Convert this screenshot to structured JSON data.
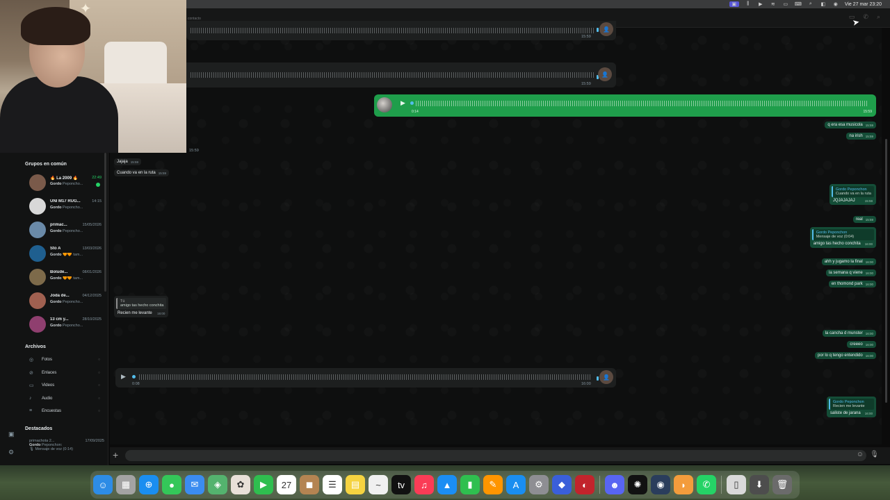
{
  "menubar": {
    "clock": "Vie 27 mar 23:20"
  },
  "chat": {
    "header_sub": "contacto",
    "top_voice_1_time": "15:59",
    "top_voice_2_time": "15:59",
    "out_voice": {
      "duration": "0:14",
      "time": "15:59"
    },
    "left_timestamp": "15:59",
    "outgoing": [
      {
        "text": "q era esa musicola",
        "time": "15:59"
      },
      {
        "text": "na irish",
        "time": "15:59"
      },
      {
        "reply_name": "Gordo Peponchon",
        "reply_text": "Cuando va en la ruta",
        "text": "JQJAJAJAJ",
        "time": "15:59"
      },
      {
        "text": "real",
        "time": "15:59"
      },
      {
        "reply_name": "Gordo Peponchon",
        "reply_text": "Mensaje de voz (0:04)",
        "text": "amigo tas hecho conchita",
        "time": "16:00"
      },
      {
        "text": "ahh y jugamo la final",
        "time": "16:00"
      },
      {
        "text": "la semana q viene",
        "time": "16:00"
      },
      {
        "text": "en thomond park",
        "time": "16:00"
      },
      {
        "text": "la cancha d munster",
        "time": "16:00"
      },
      {
        "text": "creeeo",
        "time": "16:00"
      },
      {
        "text": "por lo q tengo entendido",
        "time": "16:00"
      },
      {
        "reply_name": "Gordo Peponchon",
        "reply_text": "Recien me levante",
        "text": "saliste de jarana",
        "time": "16:00"
      }
    ],
    "incoming": [
      {
        "text": "Jajaja",
        "time": "15:59"
      },
      {
        "text": "Cuando va en la ruta",
        "time": "15:59"
      },
      {
        "reply_name": "Tú",
        "reply_text": "amigo tas hecho conchita",
        "text": "Recien me levante",
        "time": "16:00"
      }
    ],
    "in_voice": {
      "duration": "0:08",
      "time": "16:00"
    }
  },
  "sidebar": {
    "groups_title": "Grupos en común",
    "groups": [
      {
        "name": "🔥 La 2009 🔥",
        "date": "22:49",
        "sub_name": "Gordo",
        "sub_text": " Peponcho...",
        "unread": true,
        "color": "#7a5a4a"
      },
      {
        "name": "UNI M17 RUG...",
        "date": "14:15",
        "sub_name": "Gordo",
        "sub_text": " Peponcho...",
        "unread": false,
        "color": "#d8d8d8"
      },
      {
        "name": "primac...",
        "date": "15/05/2026",
        "sub_name": "Gordo",
        "sub_text": " Peponcho...",
        "unread": false,
        "color": "#6a8aa8"
      },
      {
        "name": "Sto A",
        "date": "13/03/2026",
        "sub_name": "Gordo",
        "sub_text": " 🧡🧡 tam...",
        "unread": false,
        "color": "#1f5f8f"
      },
      {
        "name": "Bolude...",
        "date": "08/01/2026",
        "sub_name": "Gordo",
        "sub_text": " 🧡🧡 tam...",
        "unread": false,
        "color": "#7d6a4a"
      },
      {
        "name": "Joda de...",
        "date": "04/12/2025",
        "sub_name": "Gordo",
        "sub_text": " Peponcho...",
        "unread": false,
        "color": "#a06050"
      },
      {
        "name": "13 cm y...",
        "date": "28/10/2025",
        "sub_name": "Gordo",
        "sub_text": " Peponcho...",
        "unread": false,
        "color": "#8f3f6f"
      }
    ],
    "files_title": "Archivos",
    "files": [
      {
        "icon": "photo-icon",
        "glyph": "◎",
        "label": "Fotos"
      },
      {
        "icon": "link-icon",
        "glyph": "⊘",
        "label": "Enlaces"
      },
      {
        "icon": "video-icon",
        "glyph": "▭",
        "label": "Videos"
      },
      {
        "icon": "music-icon",
        "glyph": "♪",
        "label": "Audio"
      },
      {
        "icon": "poll-icon",
        "glyph": "≡",
        "label": "Encuestas"
      }
    ],
    "starred_title": "Destacados",
    "starred": {
      "title": "primachota 2...",
      "date": "17/09/2025",
      "name": "Gordo",
      "name_rest": " Peponchon:",
      "text": "🎙 Mensaje de voz (0:14)"
    }
  },
  "dock": {
    "items": [
      {
        "name": "finder-icon",
        "glyph": "☺",
        "color": "#2d8ce6"
      },
      {
        "name": "launchpad-icon",
        "glyph": "▦",
        "color": "#a3a3a3"
      },
      {
        "name": "safari-icon",
        "glyph": "⊕",
        "color": "#1a8ef0"
      },
      {
        "name": "messages-icon",
        "glyph": "●",
        "color": "#34c759"
      },
      {
        "name": "mail-icon",
        "glyph": "✉",
        "color": "#3b8cf0"
      },
      {
        "name": "maps-icon",
        "glyph": "◈",
        "color": "#54b36e"
      },
      {
        "name": "photos-icon",
        "glyph": "✿",
        "color": "#e8e0d8"
      },
      {
        "name": "facetime-icon",
        "glyph": "▶",
        "color": "#2fbe4f"
      },
      {
        "name": "calendar-icon",
        "glyph": "27",
        "color": "#ffffff"
      },
      {
        "name": "brown-app-icon",
        "glyph": "◼",
        "color": "#b48452"
      },
      {
        "name": "reminders-icon",
        "glyph": "☰",
        "color": "#ffffff"
      },
      {
        "name": "notes-icon",
        "glyph": "▤",
        "color": "#f5d341"
      },
      {
        "name": "freeform-icon",
        "glyph": "~",
        "color": "#f0f0f0"
      },
      {
        "name": "appletv-icon",
        "glyph": "tv",
        "color": "#111111"
      },
      {
        "name": "music-app-icon",
        "glyph": "♫",
        "color": "#fa3c56"
      },
      {
        "name": "keynote-icon",
        "glyph": "▲",
        "color": "#1b8ef4"
      },
      {
        "name": "numbers-icon",
        "glyph": "▮",
        "color": "#2fbf4f"
      },
      {
        "name": "pages-icon",
        "glyph": "✎",
        "color": "#ff9500"
      },
      {
        "name": "appstore-icon",
        "glyph": "A",
        "color": "#1a8ef0"
      },
      {
        "name": "settings-icon",
        "glyph": "⚙",
        "color": "#8e8e93"
      },
      {
        "name": "blue-app-icon",
        "glyph": "◆",
        "color": "#3a5fd9"
      },
      {
        "name": "red-app-icon",
        "glyph": "◐",
        "color": "#c2242c"
      },
      {
        "name": "discord-icon",
        "glyph": "☻",
        "color": "#5865f2"
      },
      {
        "name": "chatgpt-icon",
        "glyph": "✺",
        "color": "#111111"
      },
      {
        "name": "davinci-icon",
        "glyph": "◉",
        "color": "#2a3d5c"
      },
      {
        "name": "fruit-app-icon",
        "glyph": "◗",
        "color": "#f39c3c"
      },
      {
        "name": "whatsapp-icon",
        "glyph": "✆",
        "color": "#25d366"
      },
      {
        "name": "preview-icon",
        "glyph": "▯",
        "color": "#d9d9d9"
      },
      {
        "name": "downloads-icon",
        "glyph": "⬇",
        "color": "#4d4d4d"
      },
      {
        "name": "trash-icon",
        "glyph": "🗑",
        "color": "#6b6b6b"
      }
    ]
  }
}
